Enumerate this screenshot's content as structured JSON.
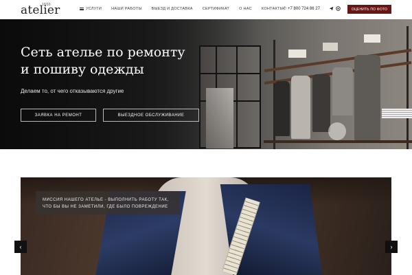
{
  "header": {
    "logo": "atelier",
    "logo_sup": "10/10",
    "nav": [
      {
        "label": "Услуги",
        "icon": "menu-icon"
      },
      {
        "label": "Наши работы"
      },
      {
        "label": "Выезд и доставка"
      },
      {
        "label": "Сертификат"
      },
      {
        "label": "О нас"
      },
      {
        "label": "Контакты"
      }
    ],
    "phone": "+7 800 724 86 27",
    "social": [
      "telegram-icon",
      "whatsapp-icon"
    ],
    "cta": "Оценить по фото",
    "cta_color": "#6b1414"
  },
  "hero": {
    "title_line1": "Сеть ателье по ремонту",
    "title_line2": "и пошиву одежды",
    "subtitle": "Делаем то, от чего отказываются другие",
    "btn_repair": "Заявка на ремонт",
    "btn_visit": "Выездное обслуживание"
  },
  "slider": {
    "caption": "Миссия нашего ателье - выполнить работу так, что бы вы не заметили, где было повреждение",
    "prev_icon": "chevron-left-icon",
    "next_icon": "chevron-right-icon"
  }
}
